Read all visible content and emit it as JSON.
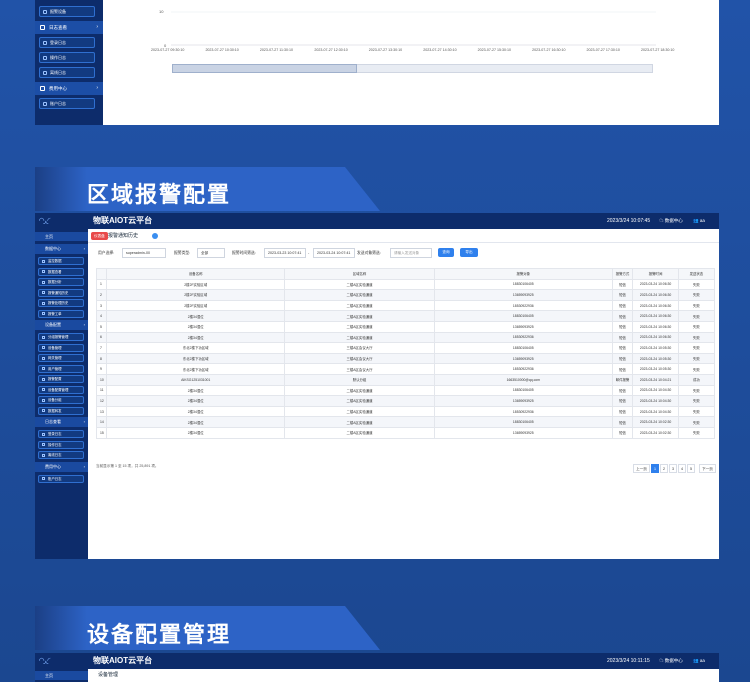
{
  "top_panel": {
    "sidebar_items": [
      {
        "label": "报警设备",
        "type": "item"
      },
      {
        "label": "日志查看",
        "type": "head"
      },
      {
        "label": "登录日志",
        "type": "item"
      },
      {
        "label": "操作日志",
        "type": "item"
      },
      {
        "label": "离线日志",
        "type": "item"
      },
      {
        "label": "费用中心",
        "type": "head"
      },
      {
        "label": "账户日志",
        "type": "item"
      }
    ],
    "y_ticks": [
      "10",
      "0"
    ],
    "x_ticks": [
      "2023-07-27 09:30:10",
      "2023-07-27 10:30:10",
      "2023-07-27 11:30:10",
      "2023-07-27 12:30:10",
      "2023-07-27 13:30:10",
      "2023-07-27 14:30:10",
      "2023-07-27 15:30:10",
      "2023-07-27 16:30:10",
      "2023-07-27 17:30:10",
      "2023-07-27 18:30:10"
    ]
  },
  "section1": {
    "title": "区域报警配置"
  },
  "section2": {
    "title": "设备配置管理"
  },
  "app": {
    "title": "物联AIOT云平台",
    "datetime": "2023/3/24 10:07:45",
    "data_center": "数据中心",
    "user": "aa",
    "home": "主页",
    "sidebar": [
      {
        "label": "数据中心",
        "type": "head"
      },
      {
        "label": "监控数据",
        "type": "item"
      },
      {
        "label": "数据查看",
        "type": "item"
      },
      {
        "label": "数据分析",
        "type": "item"
      },
      {
        "label": "报警通知历史",
        "type": "item"
      },
      {
        "label": "报警处理历史",
        "type": "item"
      },
      {
        "label": "报警工单",
        "type": "item"
      },
      {
        "label": "设备配置",
        "type": "head"
      },
      {
        "label": "分组报警管理",
        "type": "item"
      },
      {
        "label": "设备管理",
        "type": "item"
      },
      {
        "label": "网关管理",
        "type": "item"
      },
      {
        "label": "用户管理",
        "type": "item"
      },
      {
        "label": "报警配置",
        "type": "item"
      },
      {
        "label": "设备配置管理",
        "type": "item"
      },
      {
        "label": "设备分组",
        "type": "item"
      },
      {
        "label": "数据转发",
        "type": "item"
      },
      {
        "label": "日志查看",
        "type": "head"
      },
      {
        "label": "登录日志",
        "type": "item"
      },
      {
        "label": "操作日志",
        "type": "item"
      },
      {
        "label": "离线日志",
        "type": "item"
      },
      {
        "label": "费用中心",
        "type": "head"
      },
      {
        "label": "账户日志",
        "type": "item"
      }
    ],
    "tab": {
      "tag": "仪表盘",
      "name": "报警通知历史"
    },
    "filters": {
      "user_label": "用户选择:",
      "user_value": "superadmin-00",
      "type_label": "报警类型:",
      "type_value": "全部",
      "time_label": "报警时间筛选:",
      "time_start": "2023-03-23 10:07:41",
      "time_sep": "-",
      "time_end": "2023-03-24 10:07:41",
      "receiver_label": "发送对象筛选:",
      "receiver_placeholder": "请输入发送对象",
      "query_btn": "查询",
      "export_btn": "导出"
    },
    "table": {
      "headers": [
        "",
        "设备名称",
        "区域名称",
        "报警对象",
        "报警方式",
        "报警时间",
        "发送状态"
      ],
      "rows": [
        [
          "1",
          "2楼2F实验区域",
          "二楼A区实验通道",
          "18830106405",
          "短信",
          "2023-03-24 10:06:30",
          "失败"
        ],
        [
          "2",
          "2楼2F实验区域",
          "二楼A区实验通道",
          "13659093925",
          "短信",
          "2023-03-24 10:06:30",
          "失败"
        ],
        [
          "3",
          "2楼2F实验区域",
          "二楼A区实验通道",
          "18530922936",
          "短信",
          "2023-03-24 10:06:30",
          "失败"
        ],
        [
          "4",
          "2楼34湿位",
          "二楼A区实验通道",
          "18830106405",
          "短信",
          "2023-03-24 10:06:30",
          "失败"
        ],
        [
          "5",
          "2楼34湿位",
          "二楼A区实验通道",
          "13659093925",
          "短信",
          "2023-03-24 10:06:30",
          "失败"
        ],
        [
          "6",
          "2楼34湿位",
          "二楼A区实验通道",
          "18530922936",
          "短信",
          "2023-03-24 10:06:30",
          "失败"
        ],
        [
          "7",
          "东北2楼下功区域",
          "三楼A区会议大厅",
          "18830106405",
          "短信",
          "2023-03-24 10:05:30",
          "失败"
        ],
        [
          "8",
          "东北2楼下功区域",
          "三楼A区会议大厅",
          "13659093925",
          "短信",
          "2023-03-24 10:05:30",
          "失败"
        ],
        [
          "9",
          "东北2楼下功区域",
          "三楼A区会议大厅",
          "18530922936",
          "短信",
          "2023-03-24 10:05:30",
          "失败"
        ],
        [
          "10",
          "AIKSG1251031001",
          "默认分组",
          "1663510000@qq.com",
          "邮件报警",
          "2023-03-24 10:04:21",
          "成功"
        ],
        [
          "11",
          "2楼34湿位",
          "二楼A区实验通道",
          "18830106405",
          "短信",
          "2023-03-24 10:04:30",
          "失败"
        ],
        [
          "12",
          "2楼34湿位",
          "二楼A区实验通道",
          "13659093925",
          "短信",
          "2023-03-24 10:04:30",
          "失败"
        ],
        [
          "13",
          "2楼34湿位",
          "二楼A区实验通道",
          "18530922936",
          "短信",
          "2023-03-24 10:04:30",
          "失败"
        ],
        [
          "14",
          "2楼34湿位",
          "二楼A区实验通道",
          "18830106405",
          "短信",
          "2023-03-24 10:02:30",
          "失败"
        ],
        [
          "15",
          "2楼34湿位",
          "二楼A区实验通道",
          "13659093925",
          "短信",
          "2023-03-24 10:02:30",
          "失败"
        ]
      ]
    },
    "footer_text": "当前显示第 1 至 15 项，共 25,891 项。",
    "pager": {
      "prev": "上一页",
      "pages": [
        "1",
        "2",
        "3",
        "4",
        "5"
      ],
      "next": "下一页",
      "active": "1"
    }
  },
  "app3": {
    "title": "物联AIOT云平台",
    "datetime": "2023/3/24 10:11:15",
    "data_center": "数据中心",
    "user": "aa",
    "home": "主页",
    "tab_name": "设备管理"
  }
}
